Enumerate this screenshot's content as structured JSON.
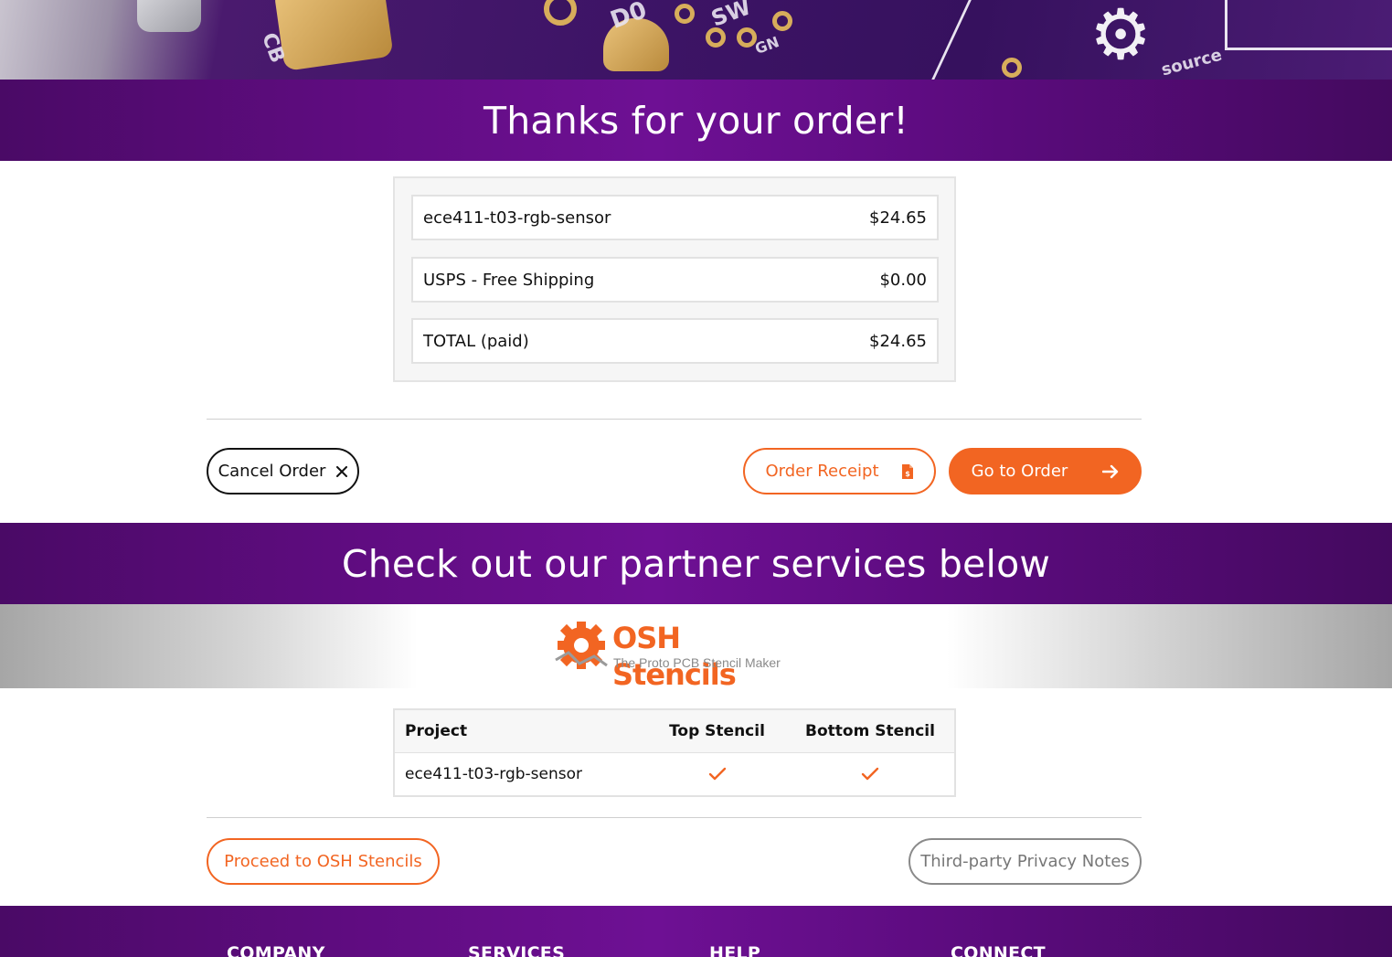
{
  "hero": {
    "silk_labels": [
      "D0",
      "SW",
      "GN",
      "CB",
      "source"
    ]
  },
  "banner_thanks": {
    "title": "Thanks for your order!"
  },
  "order_summary": {
    "rows": [
      {
        "label": "ece411-t03-rgb-sensor",
        "amount": "$24.65"
      },
      {
        "label": "USPS - Free Shipping",
        "amount": "$0.00"
      },
      {
        "label": "TOTAL (paid)",
        "amount": "$24.65"
      }
    ]
  },
  "actions": {
    "cancel_label": "Cancel Order",
    "receipt_label": "Order Receipt",
    "goto_label": "Go to Order"
  },
  "banner_partner": {
    "title": "Check out our partner services below"
  },
  "osh_stencils": {
    "logo_title": "OSH Stencils",
    "logo_tagline": "The Proto PCB Stencil Maker",
    "table": {
      "headers": {
        "project": "Project",
        "top": "Top Stencil",
        "bottom": "Bottom Stencil"
      },
      "rows": [
        {
          "project": "ece411-t03-rgb-sensor",
          "top": true,
          "bottom": true
        }
      ]
    },
    "proceed_label": "Proceed to OSH Stencils",
    "privacy_label": "Third-party Privacy Notes"
  },
  "footer": {
    "headings": [
      "COMPANY",
      "SERVICES",
      "HELP",
      "CONNECT"
    ]
  },
  "colors": {
    "brand_purple": "#5f0c80",
    "accent_orange": "#f26522"
  }
}
